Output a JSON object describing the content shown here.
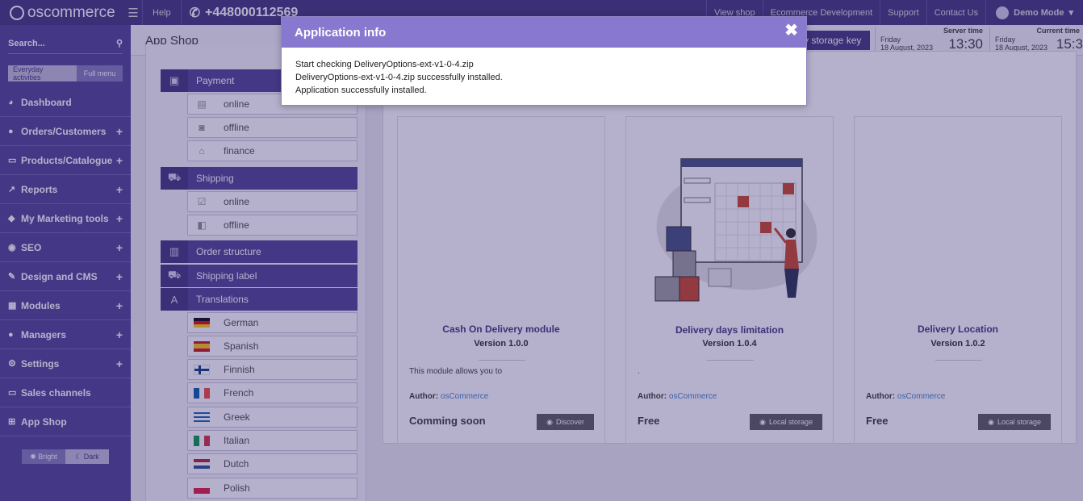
{
  "topbar": {
    "logo": "oscommerce",
    "help": "Help",
    "phone": "+448000112569",
    "links": [
      "View shop",
      "Ecommerce Development",
      "Support",
      "Contact Us"
    ],
    "demo_mode": "Demo Mode"
  },
  "sidebar": {
    "search_placeholder": "Search...",
    "toggle_everyday": "Everyday activities",
    "toggle_full": "Full menu",
    "items": [
      {
        "label": "Dashboard",
        "has_plus": false
      },
      {
        "label": "Orders/Customers",
        "has_plus": true
      },
      {
        "label": "Products/Catalogue",
        "has_plus": true
      },
      {
        "label": "Reports",
        "has_plus": true
      },
      {
        "label": "My Marketing tools",
        "has_plus": true
      },
      {
        "label": "SEO",
        "has_plus": true
      },
      {
        "label": "Design and CMS",
        "has_plus": true
      },
      {
        "label": "Modules",
        "has_plus": true
      },
      {
        "label": "Managers",
        "has_plus": true
      },
      {
        "label": "Settings",
        "has_plus": true
      },
      {
        "label": "Sales channels",
        "has_plus": false
      },
      {
        "label": "App Shop",
        "has_plus": false
      }
    ],
    "theme_bright": "Bright",
    "theme_dark": "Dark"
  },
  "header": {
    "title": "App Shop",
    "storage_key_button": "y storage key",
    "server_time_label": "Server time",
    "server_day": "Friday",
    "server_date": "18 August, 2023",
    "server_time": "13:30",
    "current_time_label": "Current time",
    "current_day": "Friday",
    "current_date": "18 August, 2023",
    "current_time": "15:3"
  },
  "tree": {
    "payment": "Payment",
    "payment_online": "online",
    "payment_offline": "offline",
    "payment_finance": "finance",
    "shipping": "Shipping",
    "shipping_online": "online",
    "shipping_offline": "offline",
    "order_structure": "Order structure",
    "shipping_label": "Shipping label",
    "translations": "Translations",
    "languages": [
      "German",
      "Spanish",
      "Finnish",
      "French",
      "Greek",
      "Italian",
      "Dutch",
      "Polish"
    ]
  },
  "cards": [
    {
      "title": "Cash On Delivery module",
      "version": "Version 1.0.0",
      "desc": "This module allows you to",
      "author_label": "Author:",
      "author": "osCommerce",
      "price": "Comming soon",
      "button": "Discover"
    },
    {
      "title": "Delivery days limitation",
      "version": "Version 1.0.4",
      "desc": ".",
      "author_label": "Author:",
      "author": "osCommerce",
      "price": "Free",
      "button": "Local storage"
    },
    {
      "title": "Delivery Location",
      "version": "Version 1.0.2",
      "desc": "",
      "author_label": "Author:",
      "author": "osCommerce",
      "price": "Free",
      "button": "Local storage"
    }
  ],
  "modal": {
    "title": "Application info",
    "lines": [
      "Start checking DeliveryOptions-ext-v1-0-4.zip",
      "DeliveryOptions-ext-v1-0-4.zip successfully installed.",
      "Application successfully installed."
    ]
  },
  "colors": {
    "brand": "#3b2e76",
    "sidebar": "#4a3d8f",
    "modal_header": "#8878d0",
    "link": "#3b7ec4"
  }
}
